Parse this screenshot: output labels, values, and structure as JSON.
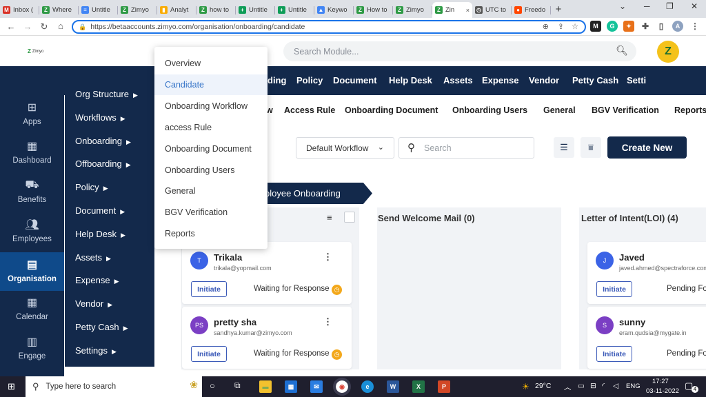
{
  "browser": {
    "tabs": [
      {
        "title": "Inbox (",
        "icon": "gmail-icon",
        "color": "#d93025",
        "glyph": "M"
      },
      {
        "title": "Where",
        "icon": "zimyo-icon",
        "color": "#2e9a45",
        "glyph": "Z"
      },
      {
        "title": "Untitle",
        "icon": "docs-icon",
        "color": "#4285f4",
        "glyph": "≡"
      },
      {
        "title": "Zimyo",
        "icon": "zimyo-icon",
        "color": "#2e9a45",
        "glyph": "Z"
      },
      {
        "title": "Analyt",
        "icon": "analytics-icon",
        "color": "#f9ab00",
        "glyph": "▮"
      },
      {
        "title": "how to",
        "icon": "zimyo-icon",
        "color": "#2e9a45",
        "glyph": "Z"
      },
      {
        "title": "Untitle",
        "icon": "sheets-icon",
        "color": "#0f9d58",
        "glyph": "+"
      },
      {
        "title": "Untitle",
        "icon": "sheets-icon",
        "color": "#0f9d58",
        "glyph": "+"
      },
      {
        "title": "Keywo",
        "icon": "ads-icon",
        "color": "#4285f4",
        "glyph": "▲"
      },
      {
        "title": "How to",
        "icon": "zimyo-icon",
        "color": "#2e9a45",
        "glyph": "Z"
      },
      {
        "title": "Zimyo",
        "icon": "zimyo-icon",
        "color": "#2e9a45",
        "glyph": "Z"
      },
      {
        "title": "Zin",
        "icon": "zimyo-icon",
        "color": "#2e9a45",
        "glyph": "Z",
        "active": true,
        "close": "×"
      },
      {
        "title": "UTC to",
        "icon": "clock-icon",
        "color": "#555555",
        "glyph": "◷"
      },
      {
        "title": "Freedo",
        "icon": "reddit-icon",
        "color": "#ff4500",
        "glyph": "●"
      }
    ],
    "new_tab": "+",
    "url": "https://betaaccounts.zimyo.com/organisation/onboarding/candidate"
  },
  "header": {
    "logo_text": "Zimyo",
    "search_placeholder": "Search Module...",
    "avatar_glyph": "Z"
  },
  "top_nav": [
    "Policy",
    "Document",
    "Help Desk",
    "Assets",
    "Expense",
    "Vendor",
    "Petty Cash",
    "Setti"
  ],
  "top_nav_partial": "ding",
  "sub_nav": [
    "Access Rule",
    "Onboarding Document",
    "Onboarding Users",
    "General",
    "BGV Verification",
    "Reports"
  ],
  "sub_nav_partial": "w",
  "rail": [
    {
      "label": "Apps",
      "icon": "apps-grid-icon"
    },
    {
      "label": "Dashboard",
      "icon": "dashboard-icon"
    },
    {
      "label": "Benefits",
      "icon": "benefits-icon"
    },
    {
      "label": "Employees",
      "icon": "employees-icon"
    },
    {
      "label": "Organisation",
      "icon": "organisation-icon",
      "selected": true
    },
    {
      "label": "Calendar",
      "icon": "calendar-icon"
    },
    {
      "label": "Engage",
      "icon": "engage-icon"
    }
  ],
  "org_menu": [
    "Org Structure",
    "Workflows",
    "Onboarding",
    "Offboarding",
    "Policy",
    "Document",
    "Help Desk",
    "Assets",
    "Expense",
    "Vendor",
    "Petty Cash",
    "Settings"
  ],
  "submenu": [
    "Overview",
    "Candidate",
    "Onboarding Workflow",
    "access Rule",
    "Onboarding Document",
    "Onboarding Users",
    "General",
    "BGV Verification",
    "Reports"
  ],
  "submenu_selected": "Candidate",
  "toolbar": {
    "workflow_select": "Default Workflow",
    "search_placeholder": "Search",
    "create_label": "Create New"
  },
  "pipeline_label": "ployee Onboarding",
  "columns": [
    {
      "title": "Send Welcome Mail (0)"
    },
    {
      "title": "Letter of Intent(LOI) (4)"
    }
  ],
  "cards_col1": [
    {
      "initials": "T",
      "name": "Trikala",
      "email": "trikala@yopmail.com",
      "button": "Initiate",
      "status": "Waiting for Response",
      "avatar_color": "#3b63e6"
    },
    {
      "initials": "PS",
      "name": "pretty sha",
      "email": "sandhya.kumar@zimyo.com",
      "button": "Initiate",
      "status": "Waiting for Response",
      "avatar_color": "#7b3fc4"
    }
  ],
  "cards_col3": [
    {
      "initials": "J",
      "name": "Javed",
      "email": "javed.ahmed@spectraforce.com",
      "button": "Initiate",
      "status": "Pending Fo",
      "avatar_color": "#3b63e6"
    },
    {
      "initials": "S",
      "name": "sunny",
      "email": "eram.qudsia@mygate.in",
      "button": "Initiate",
      "status": "Pending Fo",
      "avatar_color": "#7b3fc4"
    }
  ],
  "taskbar": {
    "search_placeholder": "Type here to search",
    "weather": "29°C",
    "lang": "ENG",
    "time": "17:27",
    "date": "03-11-2022",
    "notif_count": "4"
  }
}
